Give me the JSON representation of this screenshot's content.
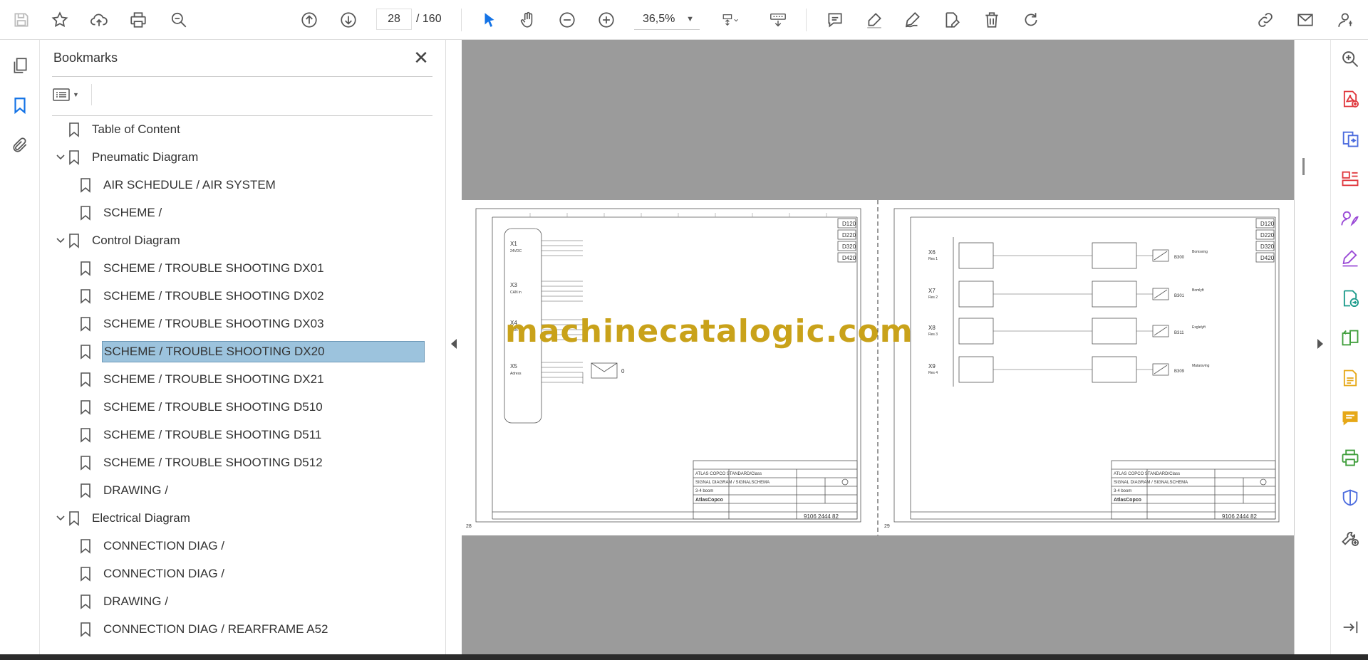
{
  "toolbar": {
    "page_current": "28",
    "page_total": "/ 160",
    "zoom": "36,5%"
  },
  "panel": {
    "title": "Bookmarks"
  },
  "bookmarks": [
    {
      "label": "Table of Content",
      "level": 0,
      "expandable": false,
      "selected": false
    },
    {
      "label": "Pneumatic Diagram",
      "level": 0,
      "expandable": true,
      "selected": false
    },
    {
      "label": "AIR SCHEDULE / AIR SYSTEM",
      "level": 1,
      "expandable": false,
      "selected": false
    },
    {
      "label": "SCHEME /",
      "level": 1,
      "expandable": false,
      "selected": false
    },
    {
      "label": "Control Diagram",
      "level": 0,
      "expandable": true,
      "selected": false
    },
    {
      "label": "SCHEME / TROUBLE SHOOTING DX01",
      "level": 1,
      "expandable": false,
      "selected": false
    },
    {
      "label": "SCHEME / TROUBLE SHOOTING DX02",
      "level": 1,
      "expandable": false,
      "selected": false
    },
    {
      "label": "SCHEME / TROUBLE SHOOTING DX03",
      "level": 1,
      "expandable": false,
      "selected": false
    },
    {
      "label": "SCHEME / TROUBLE SHOOTING DX20",
      "level": 1,
      "expandable": false,
      "selected": true
    },
    {
      "label": "SCHEME / TROUBLE SHOOTING DX21",
      "level": 1,
      "expandable": false,
      "selected": false
    },
    {
      "label": "SCHEME / TROUBLE SHOOTING D510",
      "level": 1,
      "expandable": false,
      "selected": false
    },
    {
      "label": "SCHEME / TROUBLE SHOOTING D511",
      "level": 1,
      "expandable": false,
      "selected": false
    },
    {
      "label": "SCHEME / TROUBLE SHOOTING D512",
      "level": 1,
      "expandable": false,
      "selected": false
    },
    {
      "label": "DRAWING /",
      "level": 1,
      "expandable": false,
      "selected": false
    },
    {
      "label": "Electrical Diagram",
      "level": 0,
      "expandable": true,
      "selected": false
    },
    {
      "label": "CONNECTION DIAG /",
      "level": 1,
      "expandable": false,
      "selected": false
    },
    {
      "label": "CONNECTION DIAG /",
      "level": 1,
      "expandable": false,
      "selected": false
    },
    {
      "label": "DRAWING /",
      "level": 1,
      "expandable": false,
      "selected": false
    },
    {
      "label": "CONNECTION DIAG / REARFRAME A52",
      "level": 1,
      "expandable": false,
      "selected": false
    }
  ],
  "document": {
    "watermark": "machinecatalogic.com",
    "left_page": {
      "number": "28",
      "tags": [
        "D120",
        "D220",
        "D320",
        "D420"
      ],
      "connectors": [
        "X1",
        "X3",
        "X4",
        "X5"
      ],
      "connector_subs": [
        "24VDC",
        "CAN in",
        "CAN out",
        "Adress"
      ],
      "envelope_value": "0",
      "title_company": "ATLAS COPCO STANDARD/Class",
      "title_diagram": "SIGNAL DIAGRAM / SIGNALSCHEMA",
      "title_sub": "3-4 boom",
      "drawing_no": "9106 2444 82",
      "logo": "AtlasCopco"
    },
    "right_page": {
      "number": "29",
      "tags": [
        "D120",
        "D220",
        "D320",
        "D420"
      ],
      "connectors": [
        "X6",
        "X7",
        "X8",
        "X9"
      ],
      "connector_subs": [
        "Res 1",
        "Res 2",
        "Res 3",
        "Res 4"
      ],
      "sensors": [
        "B300",
        "B301",
        "B311",
        "B309"
      ],
      "sensor_notes": [
        "Bomsving",
        "Bomlyft",
        "Exglelyft",
        "Matarsving"
      ],
      "title_company": "ATLAS COPCO STANDARD/Class",
      "title_diagram": "SIGNAL DIAGRAM / SIGNALSCHEMA",
      "title_sub": "3-4 boom",
      "drawing_no": "9106 2444 82",
      "logo": "AtlasCopco"
    }
  },
  "colors": {
    "accent": "#1473e6",
    "selection": "#9cc3dd",
    "watermark": "#c9a21a",
    "viewer_bg": "#9b9b9b"
  }
}
